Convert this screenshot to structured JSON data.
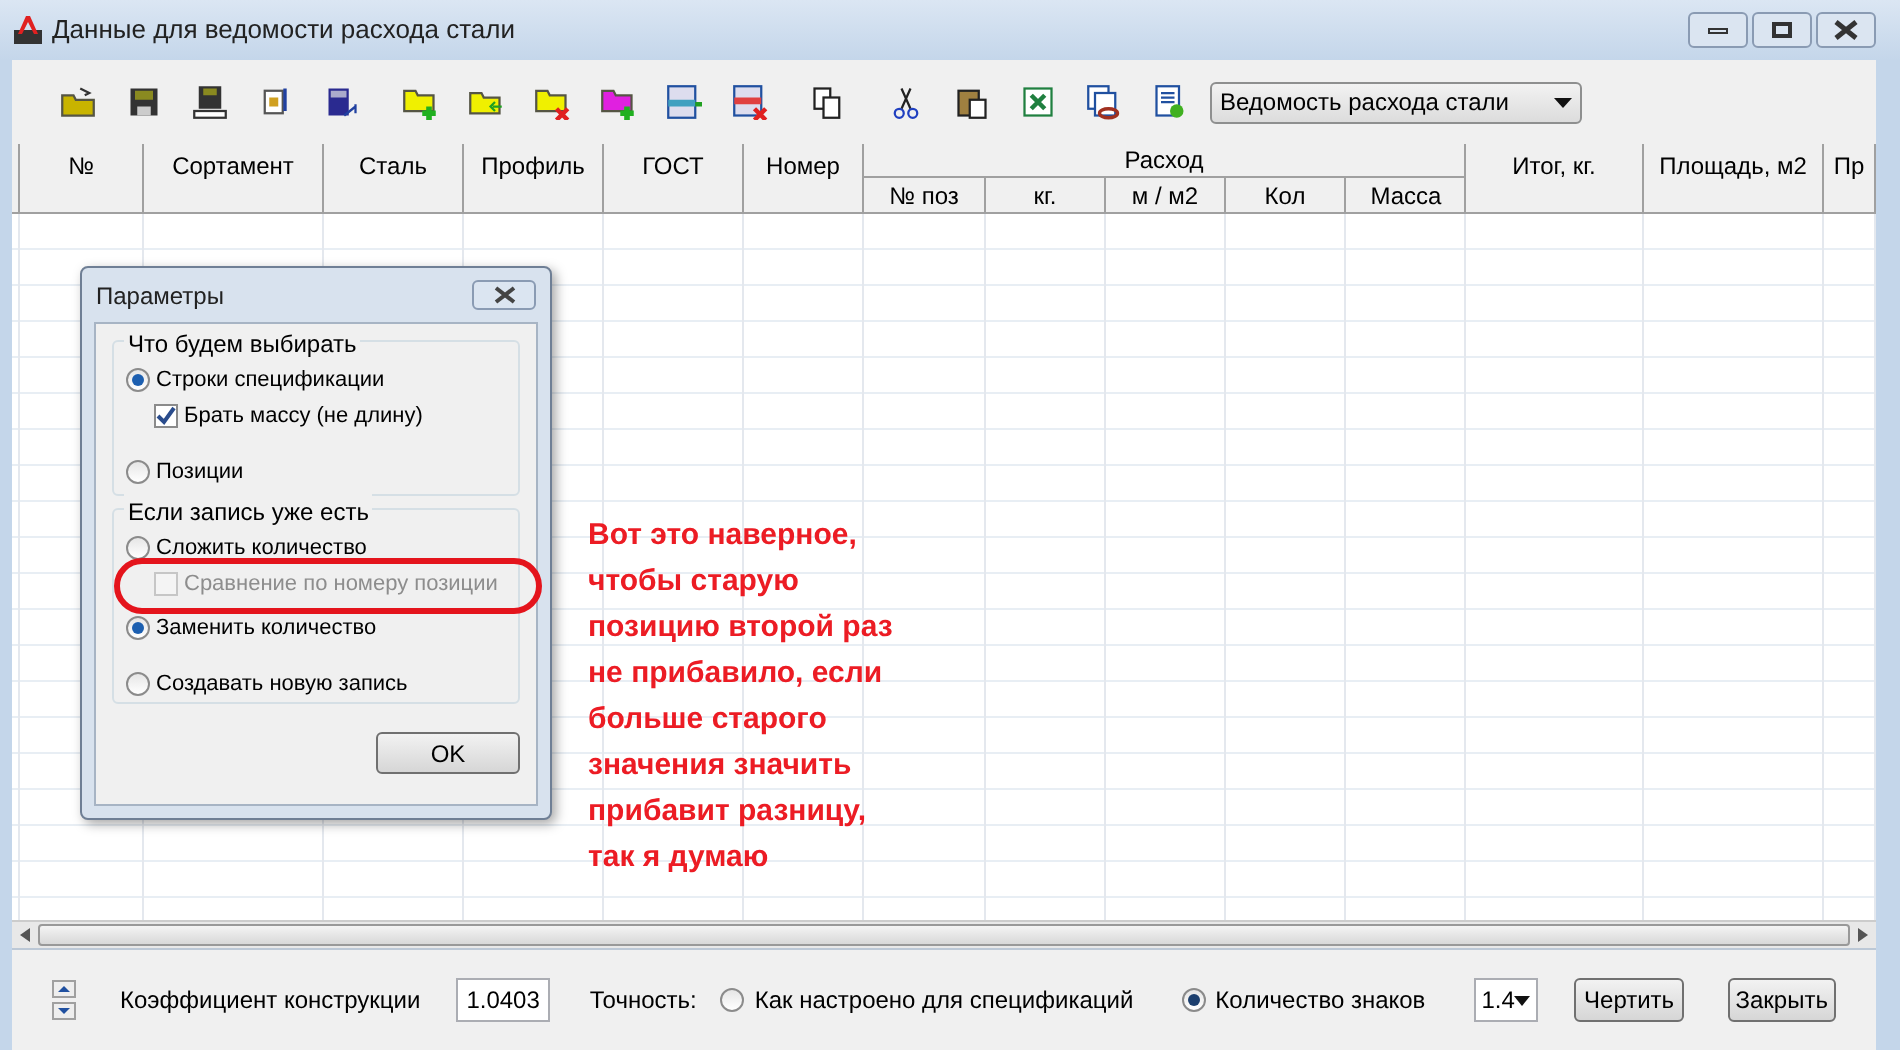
{
  "window": {
    "title": "Данные для ведомости расхода стали"
  },
  "toolbar": {
    "report_select": {
      "value": "Ведомость расхода стали"
    }
  },
  "table": {
    "columns": [
      {
        "label": "№"
      },
      {
        "label": "Сортамент"
      },
      {
        "label": "Сталь"
      },
      {
        "label": "Профиль"
      },
      {
        "label": "ГОСТ"
      },
      {
        "label": "Номер"
      },
      {
        "label": "Расход",
        "children": [
          {
            "label": "№ поз"
          },
          {
            "label": "кг."
          },
          {
            "label": "м / м2"
          },
          {
            "label": "Кол"
          },
          {
            "label": "Масса"
          }
        ]
      },
      {
        "label": "Итог, кг."
      },
      {
        "label": "Площадь, м2"
      },
      {
        "label": "Пр"
      }
    ]
  },
  "dialog": {
    "title": "Параметры",
    "groups": [
      {
        "title": "Что будем выбирать",
        "options": [
          {
            "kind": "radio",
            "label": "Строки спецификации",
            "selected": true
          },
          {
            "kind": "checkbox",
            "label": "Брать массу (не длину)",
            "checked": true,
            "disabled": false
          },
          {
            "kind": "radio",
            "label": "Позиции",
            "selected": false
          }
        ]
      },
      {
        "title": "Если запись уже есть",
        "options": [
          {
            "kind": "radio",
            "label": "Сложить количество",
            "selected": false
          },
          {
            "kind": "checkbox",
            "label": "Сравнение по номеру позиции",
            "checked": false,
            "disabled": true
          },
          {
            "kind": "radio",
            "label": "Заменить количество",
            "selected": true
          },
          {
            "kind": "radio",
            "label": "Создавать новую запись",
            "selected": false
          }
        ]
      }
    ],
    "ok_button": "OK"
  },
  "annotation": {
    "lines": [
      "Вот это наверное,",
      "чтобы старую",
      "позицию второй раз",
      "не прибавило, если",
      "больше старого",
      "значения значить",
      "прибавит разницу,",
      "так я думаю"
    ]
  },
  "bottom": {
    "coefficient_label": "Коэффициент конструкции",
    "coefficient_value": "1.0403",
    "precision_label": "Точность:",
    "precision_options": [
      {
        "label": "Как настроено для спецификаций",
        "selected": false
      },
      {
        "label": "Количество знаков",
        "selected": true
      }
    ],
    "digits": "1.4",
    "buttons": [
      "Чертить",
      "Закрыть"
    ]
  }
}
